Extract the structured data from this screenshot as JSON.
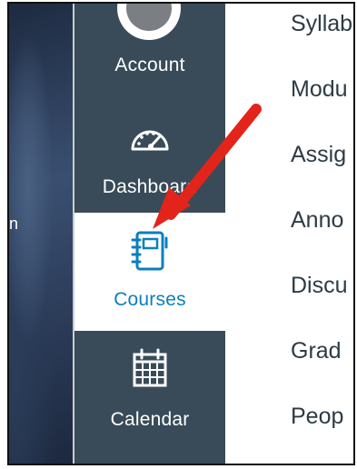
{
  "background": {
    "edge_char": "n"
  },
  "global_nav": {
    "items": [
      {
        "id": "account",
        "label": "Account",
        "icon": "avatar-icon",
        "active": false
      },
      {
        "id": "dashboard",
        "label": "Dashboard",
        "icon": "speedometer-icon",
        "active": false
      },
      {
        "id": "courses",
        "label": "Courses",
        "icon": "notebook-icon",
        "active": true
      },
      {
        "id": "calendar",
        "label": "Calendar",
        "icon": "calendar-icon",
        "active": false
      },
      {
        "id": "inbox",
        "label": "",
        "icon": "inbox-icon",
        "active": false
      }
    ]
  },
  "course_nav": {
    "links": [
      "Syllab",
      "Modu",
      "Assig",
      "Anno",
      "Discu",
      "Grad",
      "Peop"
    ]
  },
  "annotation": {
    "arrow_color": "#e3241b"
  },
  "colors": {
    "nav_bg": "#394b58",
    "active_text": "#0a7fbf",
    "link_text": "#2d3b45"
  }
}
